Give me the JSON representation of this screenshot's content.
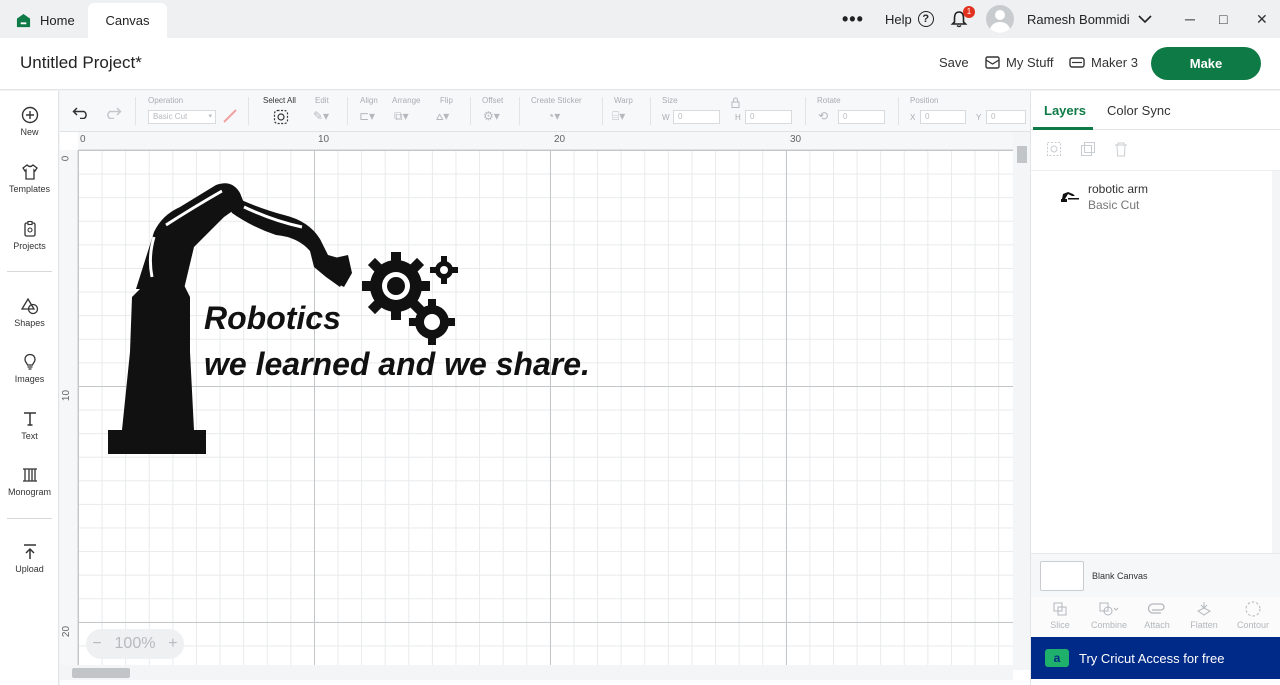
{
  "tabs": {
    "home": "Home",
    "canvas": "Canvas"
  },
  "topbar": {
    "more": "•••",
    "help": "Help",
    "help_symbol": "?",
    "notifications": "1",
    "user_name": "Ramesh Bommidi",
    "minimize": "─",
    "maximize": "□",
    "close": "✕"
  },
  "header": {
    "project_title": "Untitled Project*",
    "save": "Save",
    "my_stuff": "My Stuff",
    "machine": "Maker 3",
    "make": "Make"
  },
  "sidebar": [
    {
      "label": "New",
      "icon": "plus-circle-icon"
    },
    {
      "label": "Templates",
      "icon": "shirt-icon"
    },
    {
      "label": "Projects",
      "icon": "clipboard-icon"
    },
    {
      "label": "Shapes",
      "icon": "shapes-icon"
    },
    {
      "label": "Images",
      "icon": "bulb-icon"
    },
    {
      "label": "Text",
      "icon": "text-icon"
    },
    {
      "label": "Monogram",
      "icon": "monogram-icon"
    },
    {
      "label": "Upload",
      "icon": "upload-icon"
    }
  ],
  "toolbar": {
    "operation_label": "Operation",
    "operation_value": "Basic Cut",
    "select_all": "Select All",
    "edit": "Edit",
    "align": "Align",
    "arrange": "Arrange",
    "flip": "Flip",
    "offset": "Offset",
    "create_sticker": "Create Sticker",
    "warp": "Warp",
    "size": "Size",
    "w": "W",
    "w_value": "0",
    "h": "H",
    "h_value": "0",
    "rotate": "Rotate",
    "rotate_value": "0",
    "position": "Position",
    "x": "X",
    "x_value": "0",
    "y": "Y",
    "y_value": "0"
  },
  "canvas": {
    "ruler_top": [
      "0",
      "10",
      "20",
      "30"
    ],
    "ruler_left": [
      "0",
      "10",
      "20"
    ],
    "zoom_minus": "−",
    "zoom": "100%",
    "zoom_plus": "+",
    "design_line1": "Robotics",
    "design_line2": "we learned and we share."
  },
  "rpanel": {
    "tab_layers": "Layers",
    "tab_color_sync": "Color Sync",
    "layer_name": "robotic arm",
    "layer_op": "Basic Cut",
    "blank_canvas": "Blank Canvas",
    "tools": [
      "Slice",
      "Combine",
      "Attach",
      "Flatten",
      "Contour"
    ],
    "cricut_access": "Try Cricut Access for free"
  },
  "colors": {
    "brand_green": "#0e7a46",
    "cricut_blue": "#002a87",
    "badge_red": "#e0321f"
  }
}
